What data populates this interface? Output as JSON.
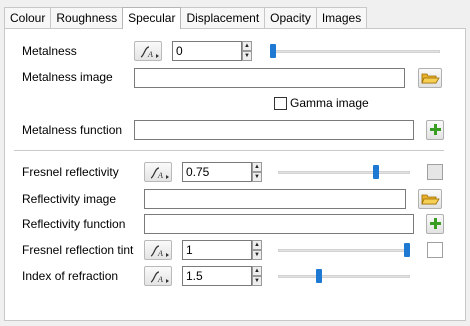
{
  "tabs": [
    {
      "label": "Colour"
    },
    {
      "label": "Roughness"
    },
    {
      "label": "Specular",
      "active": true
    },
    {
      "label": "Displacement"
    },
    {
      "label": "Opacity"
    },
    {
      "label": "Images"
    }
  ],
  "metalness": {
    "label": "Metalness",
    "value": "0",
    "slider_fraction": 0.0,
    "image_label": "Metalness image",
    "image_value": "",
    "gamma_label": "Gamma image",
    "gamma_checked": false,
    "function_label": "Metalness function",
    "function_value": ""
  },
  "fresnel": {
    "label": "Fresnel reflectivity",
    "value": "0.75",
    "slider_fraction": 0.75
  },
  "reflectivity": {
    "image_label": "Reflectivity image",
    "image_value": "",
    "function_label": "Reflectivity function",
    "function_value": ""
  },
  "tint": {
    "label": "Fresnel reflection tint",
    "value": "1",
    "slider_fraction": 1.0,
    "swatch_color": "#ffffff"
  },
  "ior": {
    "label": "Index of refraction",
    "value": "1.5",
    "slider_fraction": 0.3
  },
  "colors": {
    "accent": "#1e79d2",
    "fresnel_swatch": "#e6e6e6",
    "tint_swatch": "#ffffff"
  },
  "icons": {
    "curve": "curve-editor-icon",
    "folder": "folder-open-icon",
    "add": "plus-icon"
  }
}
